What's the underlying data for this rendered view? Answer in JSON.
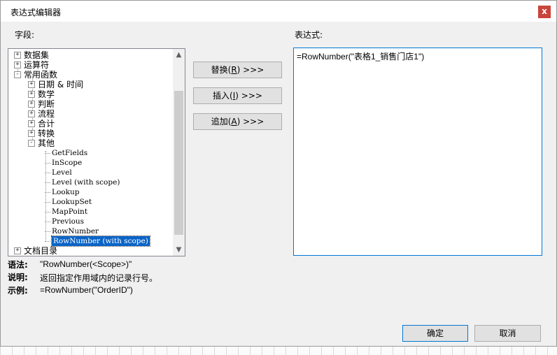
{
  "window": {
    "title": "表达式编辑器",
    "close": "x"
  },
  "fields_label": "字段:",
  "expression_label": "表达式:",
  "tree": {
    "nodes": [
      {
        "label": "数据集",
        "expander": "+"
      },
      {
        "label": "运算符",
        "expander": "+"
      },
      {
        "label": "常用函数",
        "expander": "-"
      },
      {
        "label": "日期 & 时间",
        "expander": "+"
      },
      {
        "label": "数学",
        "expander": "+"
      },
      {
        "label": "判断",
        "expander": "+"
      },
      {
        "label": "流程",
        "expander": "+"
      },
      {
        "label": "合计",
        "expander": "+"
      },
      {
        "label": "转换",
        "expander": "+"
      },
      {
        "label": "其他",
        "expander": "-"
      }
    ],
    "leaves": [
      "GetFields",
      "InScope",
      "Level",
      "Level (with scope)",
      "Lookup",
      "LookupSet",
      "MapPoint",
      "Previous",
      "RowNumber",
      "RowNumber (with scope)"
    ],
    "last_node": {
      "label": "文档目录",
      "expander": "+"
    }
  },
  "buttons": {
    "replace": {
      "label": "替换(",
      "key": "R",
      "suffix": ") >>>"
    },
    "insert": {
      "label": "插入(",
      "key": "I",
      "suffix": ") >>>"
    },
    "append": {
      "label": "追加(",
      "key": "A",
      "suffix": ") >>>"
    },
    "ok": "确定",
    "cancel": "取消"
  },
  "expression": "=RowNumber(\"表格1_销售门店1\")",
  "info": {
    "syntax_label": "语法:",
    "syntax": "\"RowNumber(<Scope>)\"",
    "desc_label": "说明:",
    "desc": "返回指定作用域内的记录行号。",
    "example_label": "示例:",
    "example": "=RowNumber(\"OrderID\")"
  }
}
